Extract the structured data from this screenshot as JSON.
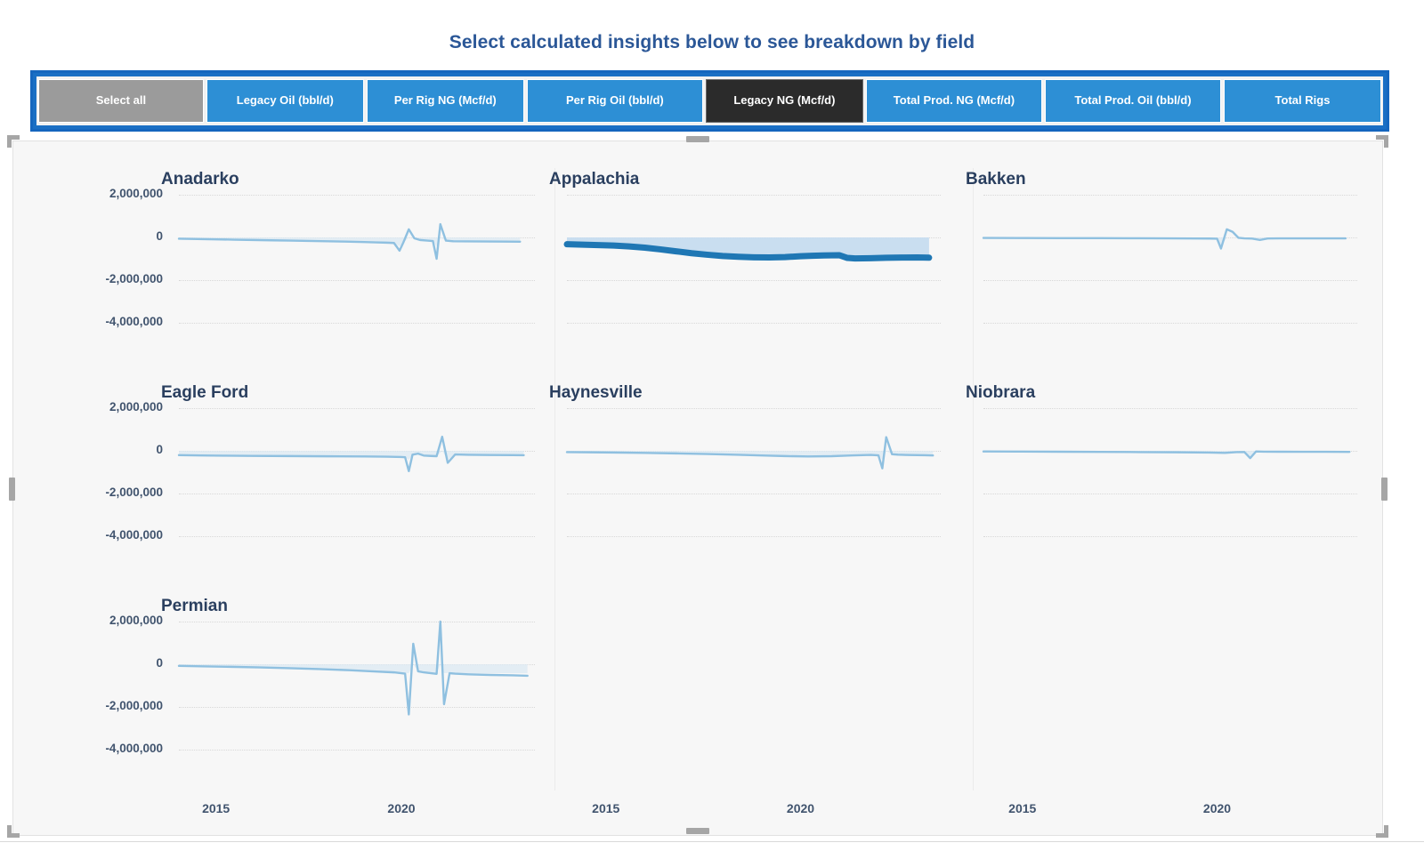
{
  "header": {
    "title": "Select calculated insights below to see breakdown by field"
  },
  "slicer": {
    "select_all_label": "Select all",
    "buttons": [
      {
        "label": "Legacy Oil (bbl/d)",
        "state": "unselected"
      },
      {
        "label": "Per Rig NG (Mcf/d)",
        "state": "unselected"
      },
      {
        "label": "Per Rig Oil (bbl/d)",
        "state": "unselected"
      },
      {
        "label": "Legacy NG (Mcf/d)",
        "state": "selected"
      },
      {
        "label": "Total Prod. NG (Mcf/d)",
        "state": "unselected"
      },
      {
        "label": "Total Prod. Oil (bbl/d)",
        "state": "unselected"
      },
      {
        "label": "Total Rigs",
        "state": "unselected"
      }
    ],
    "colors": {
      "frame": "#1a6fc4",
      "unselected": "#2d8fd5",
      "selected": "#2b2b2b",
      "select_all": "#9b9b9b"
    }
  },
  "chart_data": {
    "type": "line",
    "title": "",
    "xlabel": "",
    "ylabel": "",
    "xlim": [
      2014.0,
      2023.6
    ],
    "ylim": [
      -5000000,
      2600000
    ],
    "x_ticks": [
      2015,
      2020
    ],
    "x_tick_labels": [
      "2015",
      "2020"
    ],
    "y_ticks": [
      2000000,
      0,
      -2000000,
      -4000000
    ],
    "y_tick_labels": [
      "2,000,000",
      "0",
      "-2,000,000",
      "-4,000,000"
    ],
    "grid": true,
    "legend": "none",
    "series_color_default": "#8fc0e0",
    "series_color_highlight": "#1f77b4",
    "area_fill_default": "#dce9f3",
    "area_fill_highlight": "#c6dcef",
    "panels": [
      {
        "name": "Anadarko",
        "highlight": false,
        "x": [
          2014.0,
          2014.5,
          2015.0,
          2015.5,
          2016.0,
          2016.5,
          2017.0,
          2017.5,
          2018.0,
          2018.5,
          2019.0,
          2019.3,
          2019.6,
          2019.8,
          2019.95,
          2020.05,
          2020.2,
          2020.35,
          2020.5,
          2020.7,
          2020.85,
          2020.95,
          2021.05,
          2021.2,
          2021.4,
          2021.8,
          2022.3,
          2022.8,
          2023.2
        ],
        "y": [
          -60000,
          -75000,
          -90000,
          -105000,
          -120000,
          -135000,
          -150000,
          -165000,
          -180000,
          -195000,
          -215000,
          -230000,
          -245000,
          -260000,
          -620000,
          -250000,
          380000,
          -40000,
          -120000,
          -150000,
          -170000,
          -1000000,
          620000,
          -150000,
          -180000,
          -185000,
          -190000,
          -195000,
          -200000
        ]
      },
      {
        "name": "Appalachia",
        "highlight": true,
        "x": [
          2014.0,
          2014.4,
          2014.8,
          2015.2,
          2015.6,
          2016.0,
          2016.4,
          2016.8,
          2017.2,
          2017.6,
          2018.0,
          2018.4,
          2018.8,
          2019.2,
          2019.6,
          2020.0,
          2020.3,
          2020.6,
          2021.0,
          2021.2,
          2021.4,
          2021.8,
          2022.2,
          2022.6,
          2023.0,
          2023.3
        ],
        "y": [
          -320000,
          -340000,
          -360000,
          -380000,
          -420000,
          -480000,
          -560000,
          -650000,
          -740000,
          -810000,
          -870000,
          -905000,
          -930000,
          -940000,
          -920000,
          -880000,
          -860000,
          -845000,
          -835000,
          -960000,
          -985000,
          -975000,
          -955000,
          -945000,
          -940000,
          -950000
        ]
      },
      {
        "name": "Bakken",
        "highlight": false,
        "x": [
          2014.0,
          2015.0,
          2016.0,
          2017.0,
          2018.0,
          2018.8,
          2019.4,
          2019.8,
          2020.0,
          2020.1,
          2020.25,
          2020.4,
          2020.55,
          2020.7,
          2020.9,
          2021.1,
          2021.3,
          2021.6,
          2022.2,
          2022.8,
          2023.3
        ],
        "y": [
          -25000,
          -28000,
          -32000,
          -36000,
          -40000,
          -44000,
          -48000,
          -52000,
          -60000,
          -520000,
          380000,
          260000,
          -20000,
          -45000,
          -55000,
          -120000,
          -48000,
          -45000,
          -45000,
          -45000,
          -45000
        ]
      },
      {
        "name": "Eagle Ford",
        "highlight": false,
        "x": [
          2014.0,
          2014.6,
          2015.2,
          2016.0,
          2017.0,
          2018.0,
          2019.0,
          2019.6,
          2020.0,
          2020.1,
          2020.2,
          2020.3,
          2020.45,
          2020.6,
          2020.8,
          2020.95,
          2021.1,
          2021.25,
          2021.45,
          2021.8,
          2022.4,
          2023.0,
          2023.3
        ],
        "y": [
          -200000,
          -215000,
          -225000,
          -235000,
          -245000,
          -255000,
          -265000,
          -275000,
          -290000,
          -300000,
          -950000,
          -180000,
          -130000,
          -220000,
          -240000,
          -250000,
          660000,
          -560000,
          -170000,
          -185000,
          -195000,
          -200000,
          -205000
        ]
      },
      {
        "name": "Haynesville",
        "highlight": false,
        "x": [
          2014.0,
          2014.6,
          2015.2,
          2016.0,
          2016.8,
          2017.6,
          2018.4,
          2019.0,
          2019.6,
          2020.2,
          2020.8,
          2021.3,
          2021.8,
          2022.0,
          2022.1,
          2022.2,
          2022.35,
          2022.5,
          2022.8,
          2023.2,
          2023.4
        ],
        "y": [
          -60000,
          -68000,
          -78000,
          -95000,
          -120000,
          -150000,
          -185000,
          -215000,
          -245000,
          -265000,
          -250000,
          -215000,
          -190000,
          -210000,
          -820000,
          640000,
          -160000,
          -180000,
          -195000,
          -205000,
          -215000
        ]
      },
      {
        "name": "Niobrara",
        "highlight": false,
        "x": [
          2014.0,
          2015.0,
          2016.0,
          2017.0,
          2018.0,
          2019.0,
          2019.8,
          2020.2,
          2020.5,
          2020.7,
          2020.85,
          2021.0,
          2021.2,
          2021.6,
          2022.2,
          2022.8,
          2023.4
        ],
        "y": [
          -30000,
          -35000,
          -42000,
          -50000,
          -58000,
          -68000,
          -80000,
          -95000,
          -60000,
          -55000,
          -340000,
          -30000,
          -40000,
          -42000,
          -44000,
          -46000,
          -48000
        ]
      },
      {
        "name": "Permian",
        "highlight": false,
        "x": [
          2014.0,
          2014.6,
          2015.4,
          2016.2,
          2017.0,
          2017.8,
          2018.6,
          2019.2,
          2019.8,
          2020.0,
          2020.1,
          2020.2,
          2020.32,
          2020.45,
          2020.6,
          2020.8,
          2020.95,
          2021.05,
          2021.15,
          2021.3,
          2021.45,
          2021.8,
          2022.4,
          2023.0,
          2023.4
        ],
        "y": [
          -75000,
          -95000,
          -120000,
          -150000,
          -185000,
          -225000,
          -280000,
          -330000,
          -380000,
          -420000,
          -440000,
          -2350000,
          960000,
          -330000,
          -380000,
          -420000,
          -450000,
          2000000,
          -1870000,
          -420000,
          -440000,
          -470000,
          -500000,
          -520000,
          -540000
        ]
      }
    ]
  },
  "axis": {
    "x_labels_row": [
      "2015",
      "2020",
      "2015",
      "2020",
      "2015",
      "2020"
    ]
  }
}
